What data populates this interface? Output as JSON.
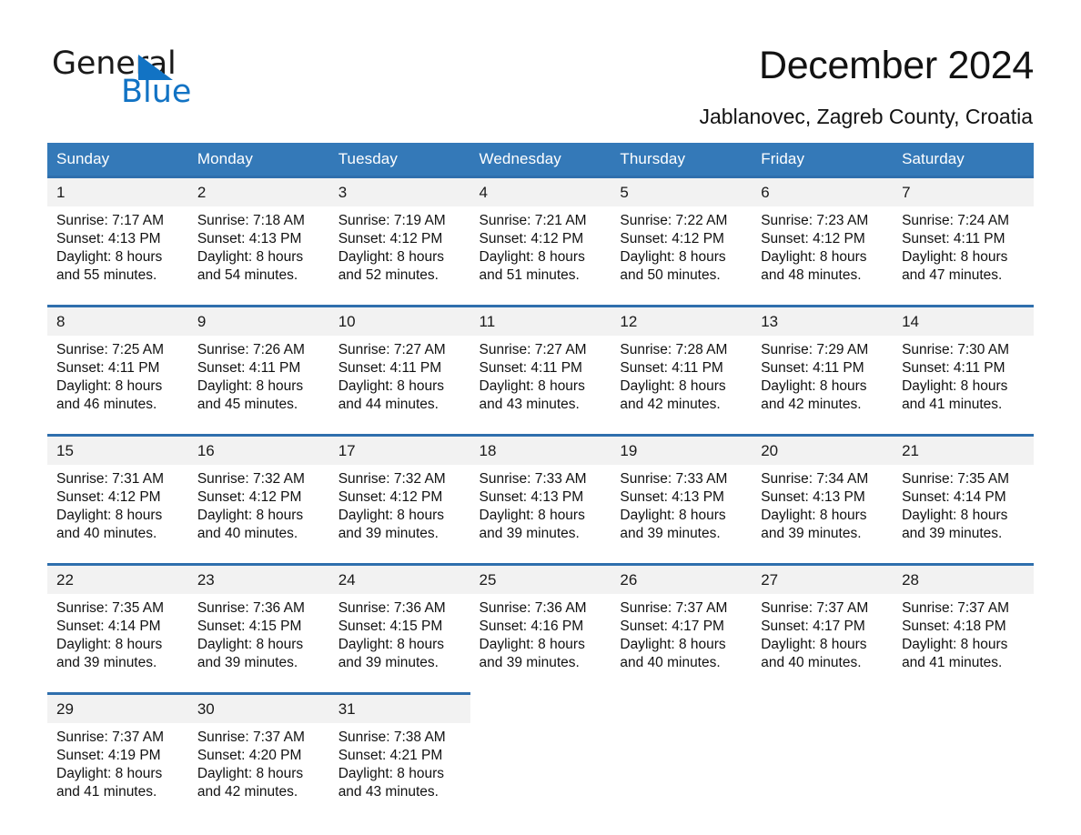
{
  "brand": {
    "name_part1": "General",
    "name_part2": "Blue",
    "accent_color": "#1273c4",
    "triangle_icon": "logo-triangle-icon"
  },
  "header": {
    "title": "December 2024",
    "subtitle": "Jablanovec, Zagreb County, Croatia"
  },
  "calendar": {
    "header_bg": "#3479b8",
    "row_rule_color": "#2f6fad",
    "daynum_bg": "#f2f2f2",
    "weekday_headers": [
      "Sunday",
      "Monday",
      "Tuesday",
      "Wednesday",
      "Thursday",
      "Friday",
      "Saturday"
    ],
    "weeks": [
      [
        {
          "day": "1",
          "sunrise": "Sunrise: 7:17 AM",
          "sunset": "Sunset: 4:13 PM",
          "daylight_line1": "Daylight: 8 hours",
          "daylight_line2": "and 55 minutes."
        },
        {
          "day": "2",
          "sunrise": "Sunrise: 7:18 AM",
          "sunset": "Sunset: 4:13 PM",
          "daylight_line1": "Daylight: 8 hours",
          "daylight_line2": "and 54 minutes."
        },
        {
          "day": "3",
          "sunrise": "Sunrise: 7:19 AM",
          "sunset": "Sunset: 4:12 PM",
          "daylight_line1": "Daylight: 8 hours",
          "daylight_line2": "and 52 minutes."
        },
        {
          "day": "4",
          "sunrise": "Sunrise: 7:21 AM",
          "sunset": "Sunset: 4:12 PM",
          "daylight_line1": "Daylight: 8 hours",
          "daylight_line2": "and 51 minutes."
        },
        {
          "day": "5",
          "sunrise": "Sunrise: 7:22 AM",
          "sunset": "Sunset: 4:12 PM",
          "daylight_line1": "Daylight: 8 hours",
          "daylight_line2": "and 50 minutes."
        },
        {
          "day": "6",
          "sunrise": "Sunrise: 7:23 AM",
          "sunset": "Sunset: 4:12 PM",
          "daylight_line1": "Daylight: 8 hours",
          "daylight_line2": "and 48 minutes."
        },
        {
          "day": "7",
          "sunrise": "Sunrise: 7:24 AM",
          "sunset": "Sunset: 4:11 PM",
          "daylight_line1": "Daylight: 8 hours",
          "daylight_line2": "and 47 minutes."
        }
      ],
      [
        {
          "day": "8",
          "sunrise": "Sunrise: 7:25 AM",
          "sunset": "Sunset: 4:11 PM",
          "daylight_line1": "Daylight: 8 hours",
          "daylight_line2": "and 46 minutes."
        },
        {
          "day": "9",
          "sunrise": "Sunrise: 7:26 AM",
          "sunset": "Sunset: 4:11 PM",
          "daylight_line1": "Daylight: 8 hours",
          "daylight_line2": "and 45 minutes."
        },
        {
          "day": "10",
          "sunrise": "Sunrise: 7:27 AM",
          "sunset": "Sunset: 4:11 PM",
          "daylight_line1": "Daylight: 8 hours",
          "daylight_line2": "and 44 minutes."
        },
        {
          "day": "11",
          "sunrise": "Sunrise: 7:27 AM",
          "sunset": "Sunset: 4:11 PM",
          "daylight_line1": "Daylight: 8 hours",
          "daylight_line2": "and 43 minutes."
        },
        {
          "day": "12",
          "sunrise": "Sunrise: 7:28 AM",
          "sunset": "Sunset: 4:11 PM",
          "daylight_line1": "Daylight: 8 hours",
          "daylight_line2": "and 42 minutes."
        },
        {
          "day": "13",
          "sunrise": "Sunrise: 7:29 AM",
          "sunset": "Sunset: 4:11 PM",
          "daylight_line1": "Daylight: 8 hours",
          "daylight_line2": "and 42 minutes."
        },
        {
          "day": "14",
          "sunrise": "Sunrise: 7:30 AM",
          "sunset": "Sunset: 4:11 PM",
          "daylight_line1": "Daylight: 8 hours",
          "daylight_line2": "and 41 minutes."
        }
      ],
      [
        {
          "day": "15",
          "sunrise": "Sunrise: 7:31 AM",
          "sunset": "Sunset: 4:12 PM",
          "daylight_line1": "Daylight: 8 hours",
          "daylight_line2": "and 40 minutes."
        },
        {
          "day": "16",
          "sunrise": "Sunrise: 7:32 AM",
          "sunset": "Sunset: 4:12 PM",
          "daylight_line1": "Daylight: 8 hours",
          "daylight_line2": "and 40 minutes."
        },
        {
          "day": "17",
          "sunrise": "Sunrise: 7:32 AM",
          "sunset": "Sunset: 4:12 PM",
          "daylight_line1": "Daylight: 8 hours",
          "daylight_line2": "and 39 minutes."
        },
        {
          "day": "18",
          "sunrise": "Sunrise: 7:33 AM",
          "sunset": "Sunset: 4:13 PM",
          "daylight_line1": "Daylight: 8 hours",
          "daylight_line2": "and 39 minutes."
        },
        {
          "day": "19",
          "sunrise": "Sunrise: 7:33 AM",
          "sunset": "Sunset: 4:13 PM",
          "daylight_line1": "Daylight: 8 hours",
          "daylight_line2": "and 39 minutes."
        },
        {
          "day": "20",
          "sunrise": "Sunrise: 7:34 AM",
          "sunset": "Sunset: 4:13 PM",
          "daylight_line1": "Daylight: 8 hours",
          "daylight_line2": "and 39 minutes."
        },
        {
          "day": "21",
          "sunrise": "Sunrise: 7:35 AM",
          "sunset": "Sunset: 4:14 PM",
          "daylight_line1": "Daylight: 8 hours",
          "daylight_line2": "and 39 minutes."
        }
      ],
      [
        {
          "day": "22",
          "sunrise": "Sunrise: 7:35 AM",
          "sunset": "Sunset: 4:14 PM",
          "daylight_line1": "Daylight: 8 hours",
          "daylight_line2": "and 39 minutes."
        },
        {
          "day": "23",
          "sunrise": "Sunrise: 7:36 AM",
          "sunset": "Sunset: 4:15 PM",
          "daylight_line1": "Daylight: 8 hours",
          "daylight_line2": "and 39 minutes."
        },
        {
          "day": "24",
          "sunrise": "Sunrise: 7:36 AM",
          "sunset": "Sunset: 4:15 PM",
          "daylight_line1": "Daylight: 8 hours",
          "daylight_line2": "and 39 minutes."
        },
        {
          "day": "25",
          "sunrise": "Sunrise: 7:36 AM",
          "sunset": "Sunset: 4:16 PM",
          "daylight_line1": "Daylight: 8 hours",
          "daylight_line2": "and 39 minutes."
        },
        {
          "day": "26",
          "sunrise": "Sunrise: 7:37 AM",
          "sunset": "Sunset: 4:17 PM",
          "daylight_line1": "Daylight: 8 hours",
          "daylight_line2": "and 40 minutes."
        },
        {
          "day": "27",
          "sunrise": "Sunrise: 7:37 AM",
          "sunset": "Sunset: 4:17 PM",
          "daylight_line1": "Daylight: 8 hours",
          "daylight_line2": "and 40 minutes."
        },
        {
          "day": "28",
          "sunrise": "Sunrise: 7:37 AM",
          "sunset": "Sunset: 4:18 PM",
          "daylight_line1": "Daylight: 8 hours",
          "daylight_line2": "and 41 minutes."
        }
      ],
      [
        {
          "day": "29",
          "sunrise": "Sunrise: 7:37 AM",
          "sunset": "Sunset: 4:19 PM",
          "daylight_line1": "Daylight: 8 hours",
          "daylight_line2": "and 41 minutes."
        },
        {
          "day": "30",
          "sunrise": "Sunrise: 7:37 AM",
          "sunset": "Sunset: 4:20 PM",
          "daylight_line1": "Daylight: 8 hours",
          "daylight_line2": "and 42 minutes."
        },
        {
          "day": "31",
          "sunrise": "Sunrise: 7:38 AM",
          "sunset": "Sunset: 4:21 PM",
          "daylight_line1": "Daylight: 8 hours",
          "daylight_line2": "and 43 minutes."
        },
        {
          "day": "",
          "sunrise": "",
          "sunset": "",
          "daylight_line1": "",
          "daylight_line2": ""
        },
        {
          "day": "",
          "sunrise": "",
          "sunset": "",
          "daylight_line1": "",
          "daylight_line2": ""
        },
        {
          "day": "",
          "sunrise": "",
          "sunset": "",
          "daylight_line1": "",
          "daylight_line2": ""
        },
        {
          "day": "",
          "sunrise": "",
          "sunset": "",
          "daylight_line1": "",
          "daylight_line2": ""
        }
      ]
    ]
  }
}
